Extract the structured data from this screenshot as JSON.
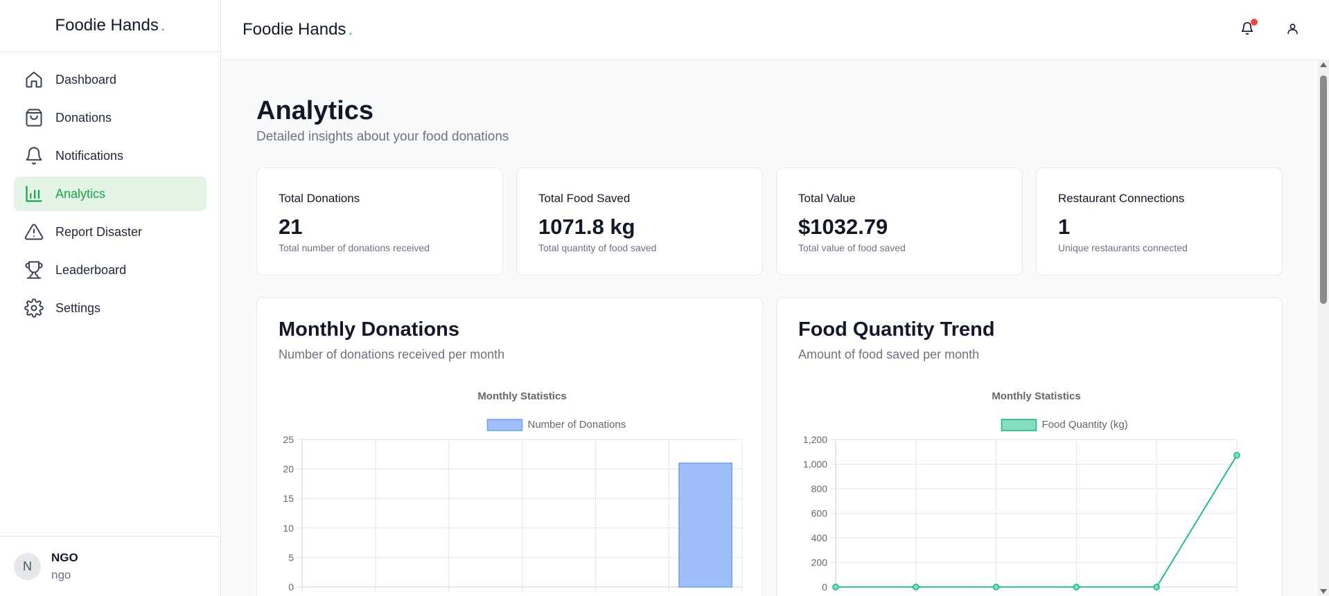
{
  "app": {
    "brand": "Foodie Hands",
    "brand_dot": "."
  },
  "sidebar": {
    "items": [
      {
        "label": "Dashboard",
        "icon": "home-icon"
      },
      {
        "label": "Donations",
        "icon": "bag-icon"
      },
      {
        "label": "Notifications",
        "icon": "bell-icon"
      },
      {
        "label": "Analytics",
        "icon": "bar-chart-icon",
        "active": true
      },
      {
        "label": "Report Disaster",
        "icon": "warning-icon"
      },
      {
        "label": "Leaderboard",
        "icon": "trophy-icon"
      },
      {
        "label": "Settings",
        "icon": "gear-icon"
      }
    ],
    "user": {
      "initial": "N",
      "name": "NGO",
      "role": "ngo"
    }
  },
  "header": {
    "has_notification": true
  },
  "page": {
    "title": "Analytics",
    "subtitle": "Detailed insights about your food donations"
  },
  "stats": [
    {
      "label": "Total Donations",
      "value": "21",
      "desc": "Total number of donations received"
    },
    {
      "label": "Total Food Saved",
      "value": "1071.8 kg",
      "desc": "Total quantity of food saved"
    },
    {
      "label": "Total Value",
      "value": "$1032.79",
      "desc": "Total value of food saved"
    },
    {
      "label": "Restaurant Connections",
      "value": "1",
      "desc": "Unique restaurants connected"
    }
  ],
  "cards": [
    {
      "title": "Monthly Donations",
      "subtitle": "Number of donations received per month"
    },
    {
      "title": "Food Quantity Trend",
      "subtitle": "Amount of food saved per month"
    }
  ],
  "colors": {
    "accent": "#16a34a",
    "active_bg": "#e3f4e7",
    "bar_fill": "#9ebff7",
    "bar_stroke": "#6b9ef0",
    "line": "#10b981",
    "line_fill": "#86dcc0",
    "notify": "#ef4444"
  },
  "chart_data": [
    {
      "type": "bar",
      "title": "Monthly Statistics",
      "legend": "top",
      "ylim": [
        0,
        25
      ],
      "yticks": [
        "0",
        "5",
        "10",
        "15",
        "20",
        "25"
      ],
      "grid": true,
      "categories_count": 6,
      "series": [
        {
          "name": "Number of Donations",
          "values": [
            0,
            0,
            0,
            0,
            0,
            21
          ]
        }
      ]
    },
    {
      "type": "line",
      "title": "Monthly Statistics",
      "legend": "top",
      "ylim": [
        0,
        1200
      ],
      "yticks": [
        "0",
        "200",
        "400",
        "600",
        "800",
        "1,000",
        "1,200"
      ],
      "grid": true,
      "categories_count": 6,
      "series": [
        {
          "name": "Food Quantity (kg)",
          "values": [
            0,
            0,
            0,
            0,
            0,
            1071.8
          ]
        }
      ]
    }
  ]
}
